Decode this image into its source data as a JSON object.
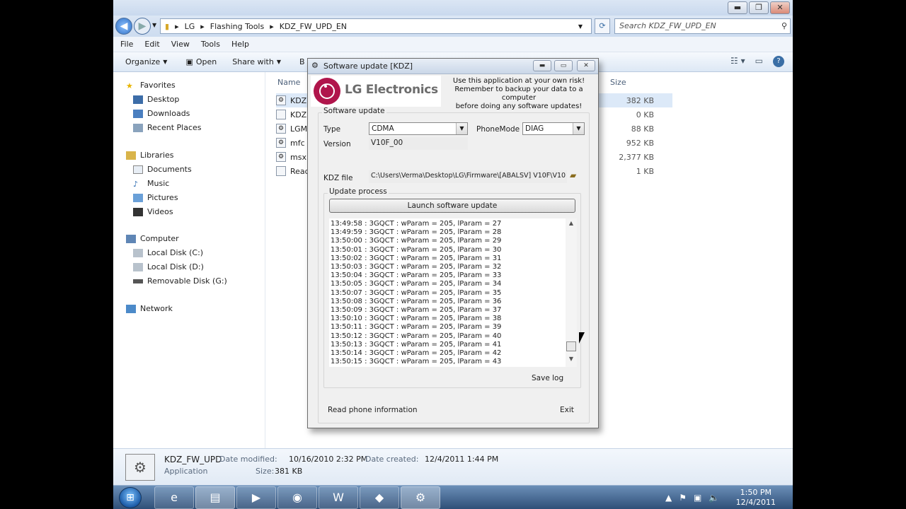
{
  "explorer": {
    "breadcrumb": [
      "LG",
      "Flashing Tools",
      "KDZ_FW_UPD_EN"
    ],
    "search_placeholder": "Search KDZ_FW_UPD_EN",
    "menu": [
      "File",
      "Edit",
      "View",
      "Tools",
      "Help"
    ],
    "commands": {
      "organize": "Organize",
      "open": "Open",
      "share": "Share with",
      "extra": "B"
    },
    "columns": {
      "name": "Name",
      "size": "Size"
    },
    "nav": {
      "favorites": "Favorites",
      "desktop": "Desktop",
      "downloads": "Downloads",
      "recent": "Recent Places",
      "libraries": "Libraries",
      "documents": "Documents",
      "music": "Music",
      "pictures": "Pictures",
      "videos": "Videos",
      "computer": "Computer",
      "disk_c": "Local Disk (C:)",
      "disk_d": "Local Disk (D:)",
      "disk_g": "Removable Disk (G:)",
      "network": "Network"
    },
    "files": [
      {
        "name": "KDZ",
        "size": "382 KB"
      },
      {
        "name": "KDZ",
        "size": "0 KB"
      },
      {
        "name": "LGM",
        "size": "88 KB"
      },
      {
        "name": "mfc",
        "size": "952 KB"
      },
      {
        "name": "msx",
        "size": "2,377 KB"
      },
      {
        "name": "Read",
        "size": "1 KB"
      }
    ],
    "details": {
      "name": "KDZ_FW_UPD",
      "type": "Application",
      "modified_label": "Date modified:",
      "modified": "10/16/2010 2:32 PM",
      "created_label": "Date created:",
      "created": "12/4/2011 1:44 PM",
      "size_label": "Size:",
      "size": "381 KB"
    }
  },
  "dialog": {
    "title": "Software update [KDZ]",
    "logo_text": "LG Electronics",
    "warning_line1": "Use this application at your own risk!",
    "warning_line2": "Remember to backup your data to a computer",
    "warning_line3": "before doing any software updates!",
    "group_label": "Software update",
    "type_label": "Type",
    "type_value": "CDMA",
    "phonemode_label": "PhoneMode",
    "phonemode_value": "DIAG",
    "version_label": "Version",
    "version_value": "V10F_00",
    "kdz_label": "KDZ file",
    "kdz_value": "C:\\Users\\Verma\\Desktop\\LG\\Firmware\\[ABALSV] V10F\\V10",
    "process_label": "Update process",
    "launch_button": "Launch software update",
    "log_lines": [
      "13:49:58 : 3GQCT : wParam = 205, lParam = 27",
      "13:49:59 : 3GQCT : wParam = 205, lParam = 28",
      "13:50:00 : 3GQCT : wParam = 205, lParam = 29",
      "13:50:01 : 3GQCT : wParam = 205, lParam = 30",
      "13:50:02 : 3GQCT : wParam = 205, lParam = 31",
      "13:50:03 : 3GQCT : wParam = 205, lParam = 32",
      "13:50:04 : 3GQCT : wParam = 205, lParam = 33",
      "13:50:05 : 3GQCT : wParam = 205, lParam = 34",
      "13:50:07 : 3GQCT : wParam = 205, lParam = 35",
      "13:50:08 : 3GQCT : wParam = 205, lParam = 36",
      "13:50:09 : 3GQCT : wParam = 205, lParam = 37",
      "13:50:10 : 3GQCT : wParam = 205, lParam = 38",
      "13:50:11 : 3GQCT : wParam = 205, lParam = 39",
      "13:50:12 : 3GQCT : wParam = 205, lParam = 40",
      "13:50:13 : 3GQCT : wParam = 205, lParam = 41",
      "13:50:14 : 3GQCT : wParam = 205, lParam = 42",
      "13:50:15 : 3GQCT : wParam = 205, lParam = 43"
    ],
    "save_log": "Save log",
    "read_phone": "Read phone information",
    "exit": "Exit"
  },
  "taskbar": {
    "time": "1:50 PM",
    "date": "12/4/2011"
  },
  "icons": {
    "start": "windows-orb-icon",
    "ie": "internet-explorer-icon",
    "explorer": "folder-icon",
    "media": "media-player-icon",
    "firefox": "firefox-icon",
    "word": "word-icon",
    "tool": "flash-tool-icon",
    "kdz": "kdz-gear-icon"
  }
}
